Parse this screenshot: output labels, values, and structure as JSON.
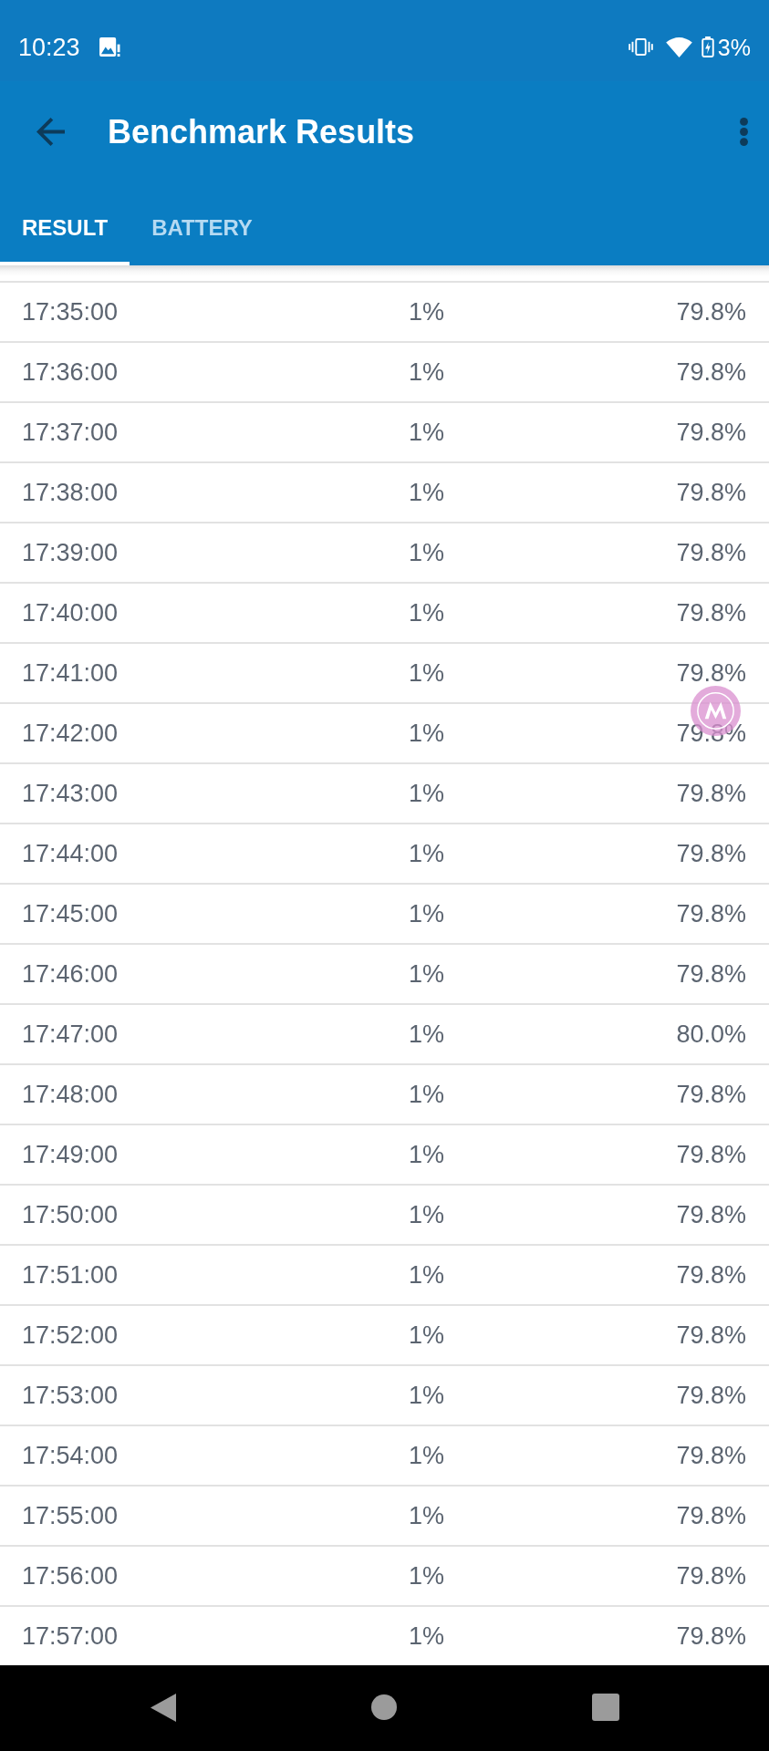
{
  "status_bar": {
    "time": "10:23",
    "battery": "3%"
  },
  "app_bar": {
    "title": "Benchmark Results"
  },
  "tabs": [
    {
      "label": "RESULT",
      "selected": true
    },
    {
      "label": "BATTERY",
      "selected": false
    }
  ],
  "table": {
    "rows": [
      [
        "17:35:00",
        "1%",
        "79.8%"
      ],
      [
        "17:36:00",
        "1%",
        "79.8%"
      ],
      [
        "17:37:00",
        "1%",
        "79.8%"
      ],
      [
        "17:38:00",
        "1%",
        "79.8%"
      ],
      [
        "17:39:00",
        "1%",
        "79.8%"
      ],
      [
        "17:40:00",
        "1%",
        "79.8%"
      ],
      [
        "17:41:00",
        "1%",
        "79.8%"
      ],
      [
        "17:42:00",
        "1%",
        "79.8%"
      ],
      [
        "17:43:00",
        "1%",
        "79.8%"
      ],
      [
        "17:44:00",
        "1%",
        "79.8%"
      ],
      [
        "17:45:00",
        "1%",
        "79.8%"
      ],
      [
        "17:46:00",
        "1%",
        "79.8%"
      ],
      [
        "17:47:00",
        "1%",
        "80.0%"
      ],
      [
        "17:48:00",
        "1%",
        "79.8%"
      ],
      [
        "17:49:00",
        "1%",
        "79.8%"
      ],
      [
        "17:50:00",
        "1%",
        "79.8%"
      ],
      [
        "17:51:00",
        "1%",
        "79.8%"
      ],
      [
        "17:52:00",
        "1%",
        "79.8%"
      ],
      [
        "17:53:00",
        "1%",
        "79.8%"
      ],
      [
        "17:54:00",
        "1%",
        "79.8%"
      ],
      [
        "17:55:00",
        "1%",
        "79.8%"
      ],
      [
        "17:56:00",
        "1%",
        "79.8%"
      ],
      [
        "17:57:00",
        "1%",
        "79.8%"
      ]
    ]
  }
}
